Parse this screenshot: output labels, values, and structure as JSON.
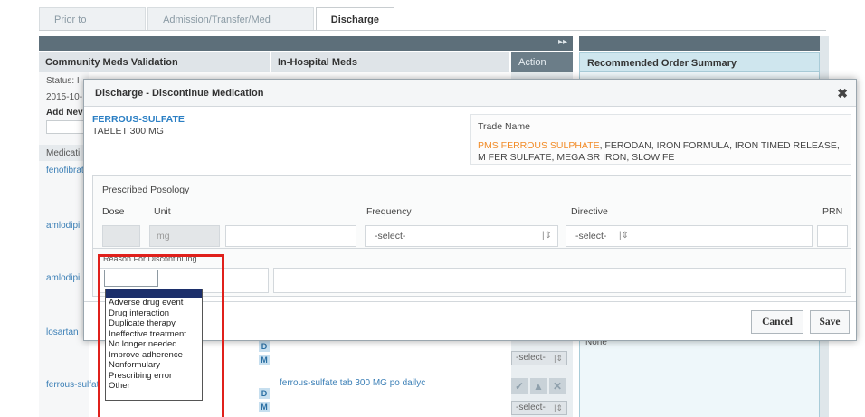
{
  "tabs": [
    {
      "label": "Prior to Admission",
      "active": false
    },
    {
      "label": "Admission/Transfer/Med Review",
      "active": false
    },
    {
      "label": "Discharge",
      "active": true
    }
  ],
  "background": {
    "expand_glyph": "▸▸",
    "columns": {
      "community": "Community Meds Validation",
      "inhospital": "In-Hospital Meds",
      "action": "Action",
      "recommended": "Recommended Order Summary"
    },
    "left_snippets": {
      "status": "Status: I",
      "date": "2015-10-",
      "add_new": "Add Nev",
      "medication": "Medicati",
      "rows": [
        "fenofibrat",
        "amlodipi",
        "amlodipi",
        "losartan",
        "ferrous-sulfat"
      ]
    },
    "inhospital_row": "ferrous-sulfate tab 300 MG po dailyc",
    "right_snippet": "None",
    "badges": {
      "d": "D",
      "m": "M"
    },
    "action_select": "-select-",
    "action_buttons": [
      "✓",
      "▲",
      "✕"
    ]
  },
  "modal": {
    "title": "Discharge - Discontinue Medication",
    "close_glyph": "✖",
    "drug_name": "FERROUS-SULFATE",
    "drug_form": "TABLET 300 MG",
    "trade_label": "Trade Name",
    "trade_first": "PMS FERROUS SULPHATE",
    "trade_rest": ", FERODAN, IRON FORMULA, IRON TIMED RELEASE, M FER SULFATE, MEGA SR IRON, SLOW FE",
    "posology": {
      "title": "Prescribed Posology",
      "dose_label": "Dose",
      "unit_label": "Unit",
      "unit_value": "mg",
      "frequency_label": "Frequency",
      "frequency_value": "-select-",
      "directive_label": "Directive",
      "directive_value": "-select-",
      "prn_label": "PRN"
    },
    "reason_label": "Reason For Discontinuing",
    "cancel": "Cancel",
    "save": "Save"
  },
  "dropdown": {
    "options": [
      "Adverse drug event",
      "Drug interaction",
      "Duplicate therapy",
      "Ineffective treatment",
      "No longer needed",
      "Improve adherence",
      "Nonformulary",
      "Prescribing error",
      "Other"
    ]
  },
  "colors": {
    "link": "#2b7fc4",
    "trade_highlight": "#f28c28",
    "header_bar": "#5d6f7a",
    "selected_option": "#1c2f6b",
    "annotation_red": "#e0201b"
  }
}
